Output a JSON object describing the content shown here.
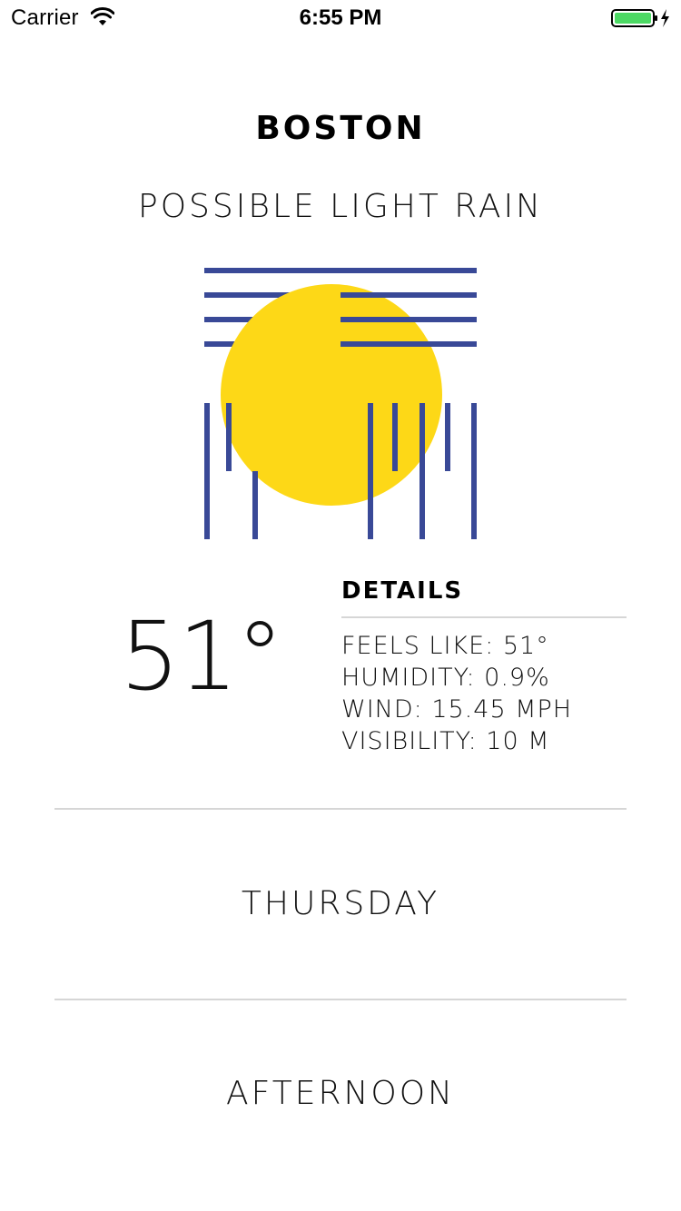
{
  "status_bar": {
    "carrier": "Carrier",
    "time": "6:55 PM",
    "wifi_icon": "wifi-icon",
    "battery_icon": "battery-charging-icon",
    "battery_color": "#4cd964"
  },
  "weather": {
    "city": "BOSTON",
    "condition": "POSSIBLE LIGHT RAIN",
    "temperature": "51°",
    "icon": "sun-with-clouds-and-rain-icon",
    "icon_colors": {
      "sun": "#fdd817",
      "lines": "#394997"
    }
  },
  "details": {
    "title": "DETAILS",
    "items": [
      "FEELS LIKE: 51°",
      "HUMIDITY: 0.9%",
      "WIND: 15.45 MPH",
      "VISIBILITY: 10 M"
    ]
  },
  "forecast": {
    "day": "THURSDAY",
    "period": "AFTERNOON"
  }
}
